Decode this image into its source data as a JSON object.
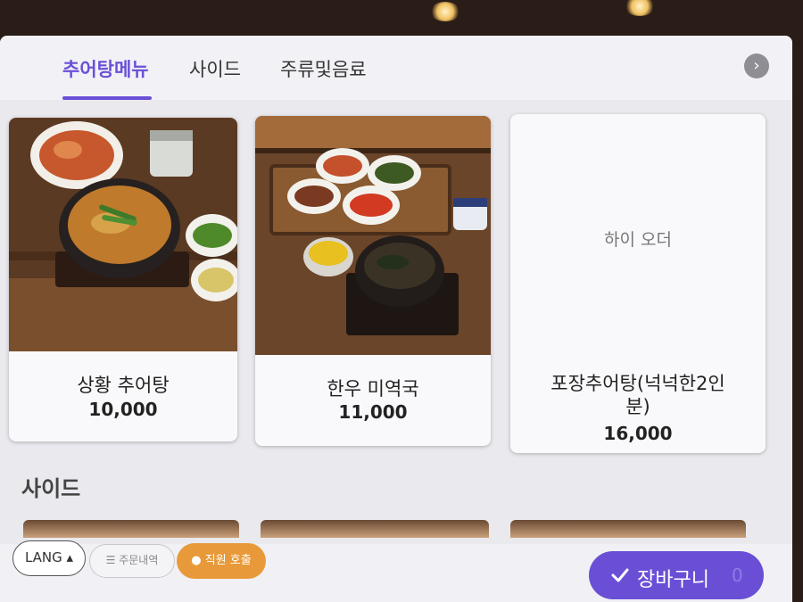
{
  "tabs": [
    {
      "label": "추어탕메뉴",
      "active": true
    },
    {
      "label": "사이드",
      "active": false
    },
    {
      "label": "주류및음료",
      "active": false
    }
  ],
  "next_icon": "chevron-right",
  "menu_items": [
    {
      "name": "상황 추어탕",
      "price": "10,000"
    },
    {
      "name": "한우 미역국",
      "price": "11,000"
    },
    {
      "name": "포장추어탕(넉넉한2인분)",
      "name_line1": "포장추어탕(넉넉한2인",
      "name_line2": "분)",
      "price": "16,000",
      "image_placeholder": "하이 오더"
    }
  ],
  "section_title": "사이드",
  "bottom": {
    "lang_label": "LANG ▴",
    "order_history_label": "주문내역",
    "order_history_icon": "list-icon",
    "staff_call_label": "직원 호출",
    "staff_call_icon": "person-icon",
    "cart_label": "장바구니",
    "cart_icon": "check-icon",
    "cart_count": "0"
  },
  "colors": {
    "accent": "#6b4fd8",
    "staff_call": "#e89a3a",
    "cart": "#6a4fd6"
  }
}
